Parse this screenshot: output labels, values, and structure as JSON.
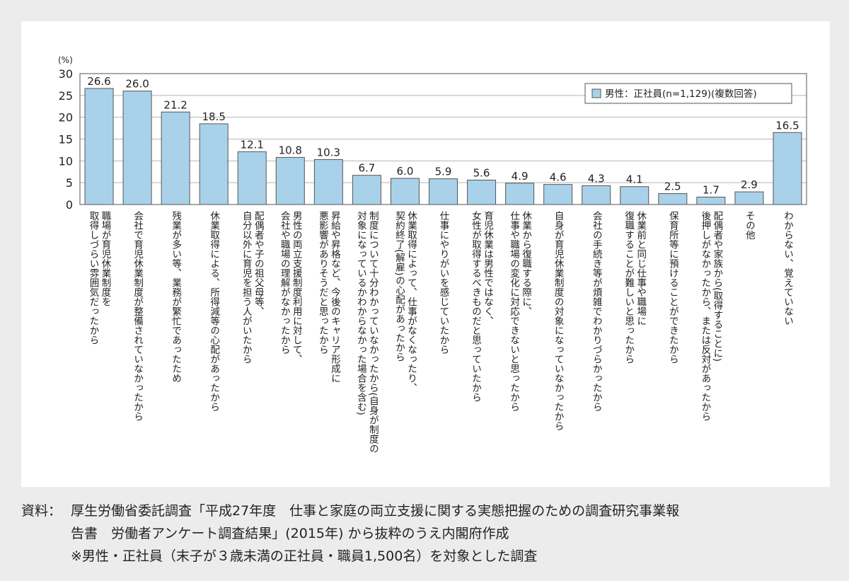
{
  "chart_data": {
    "type": "bar",
    "unit_label": "(%)",
    "ylim": [
      0,
      30
    ],
    "yticks": [
      0,
      5,
      10,
      15,
      20,
      25,
      30
    ],
    "grid": true,
    "legend_position": "top-right",
    "bar_color": "#a9d2ea",
    "bar_edge_color": "#555555",
    "series": [
      {
        "name": "男性：正社員(n=1,129)(複数回答)",
        "values": [
          26.6,
          26.0,
          21.2,
          18.5,
          12.1,
          10.8,
          10.3,
          6.7,
          6.0,
          5.9,
          5.6,
          4.9,
          4.6,
          4.3,
          4.1,
          2.5,
          1.7,
          2.9,
          16.5
        ]
      }
    ],
    "value_labels": [
      "26.6",
      "26.0",
      "21.2",
      "18.5",
      "12.1",
      "10.8",
      "10.3",
      "6.7",
      "6.0",
      "5.9",
      "5.6",
      "4.9",
      "4.6",
      "4.3",
      "4.1",
      "2.5",
      "1.7",
      "2.9",
      "16.5"
    ],
    "categories": [
      [
        "職場が育児休業制度を",
        "取得しづらい雰囲気だったから"
      ],
      [
        "会社で育児休業制度が整備されていなかったから"
      ],
      [
        "残業が多い等、業務が繁忙であったため"
      ],
      [
        "休業取得による、所得減等の心配があったから"
      ],
      [
        "配偶者や子の祖父母等、",
        "自分以外に育児を担う人がいたから"
      ],
      [
        "男性の両立支援制度利用に対して、",
        "会社や職場の理解がなかったから"
      ],
      [
        "昇給や昇格など、今後のキャリア形成に",
        "悪影響がありそうだと思ったから"
      ],
      [
        "制度について十分わかっていなかったから(自身が制度の",
        "対象になっているかわからなかった場合を含む)"
      ],
      [
        "休業取得によって、仕事がなくなったり、",
        "契約終了(解雇)の心配があったから"
      ],
      [
        "仕事にやりがいを感じていたから"
      ],
      [
        "育児休業は男性ではなく、",
        "女性が取得するべきものだと思っていたから"
      ],
      [
        "休業から復職する際に、",
        "仕事や職場の変化に対応できないと思ったから"
      ],
      [
        "自身が育児休業制度の対象になっていなかったから"
      ],
      [
        "会社の手続き等が煩雑でわかりづらかったから"
      ],
      [
        "休業前と同じ仕事や職場に",
        "復職することが難しいと思ったから"
      ],
      [
        "保育所等に預けることができたから"
      ],
      [
        "配偶者や家族から(取得することに)",
        "後押しがなかったから、または反対があったから"
      ],
      [
        "その他"
      ],
      [
        "わからない、覚えていない"
      ]
    ]
  },
  "source": {
    "label": "資料：",
    "line1": "厚生労働省委託調査「平成27年度　仕事と家庭の両立支援に関する実態把握のための調査研究事業報",
    "line2": "告書　労働者アンケート調査結果」(2015年) から抜粋のうえ内閣府作成",
    "line3": "※男性・正社員（末子が３歳未満の正社員・職員1,500名）を対象とした調査"
  }
}
